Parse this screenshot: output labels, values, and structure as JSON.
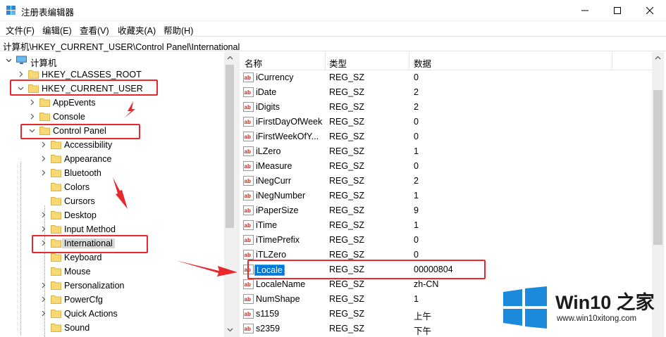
{
  "window": {
    "title": "注册表编辑器"
  },
  "menu": [
    {
      "label": "文件(F)"
    },
    {
      "label": "编辑(E)"
    },
    {
      "label": "查看(V)"
    },
    {
      "label": "收藏夹(A)"
    },
    {
      "label": "帮助(H)"
    }
  ],
  "address": {
    "path": "计算机\\HKEY_CURRENT_USER\\Control Panel\\International"
  },
  "tree": {
    "root": "计算机",
    "items": [
      {
        "label": "HKEY_CLASSES_ROOT",
        "expander": "collapsed"
      },
      {
        "label": "HKEY_CURRENT_USER",
        "expander": "expanded"
      },
      {
        "label": "AppEvents",
        "expander": "collapsed"
      },
      {
        "label": "Console",
        "expander": "collapsed"
      },
      {
        "label": "Control Panel",
        "expander": "expanded"
      },
      {
        "label": "Accessibility",
        "expander": "collapsed"
      },
      {
        "label": "Appearance",
        "expander": "collapsed"
      },
      {
        "label": "Bluetooth",
        "expander": "collapsed"
      },
      {
        "label": "Colors",
        "expander": "none"
      },
      {
        "label": "Cursors",
        "expander": "none"
      },
      {
        "label": "Desktop",
        "expander": "collapsed"
      },
      {
        "label": "Input Method",
        "expander": "collapsed"
      },
      {
        "label": "International",
        "expander": "collapsed",
        "selected": true
      },
      {
        "label": "Keyboard",
        "expander": "none"
      },
      {
        "label": "Mouse",
        "expander": "none"
      },
      {
        "label": "Personalization",
        "expander": "collapsed"
      },
      {
        "label": "PowerCfg",
        "expander": "collapsed"
      },
      {
        "label": "Quick Actions",
        "expander": "collapsed"
      },
      {
        "label": "Sound",
        "expander": "none"
      }
    ]
  },
  "list": {
    "columns": {
      "name": "名称",
      "type": "类型",
      "data": "数据"
    },
    "rows": [
      {
        "name": "iCurrency",
        "type": "REG_SZ",
        "data": "0"
      },
      {
        "name": "iDate",
        "type": "REG_SZ",
        "data": "2"
      },
      {
        "name": "iDigits",
        "type": "REG_SZ",
        "data": "2"
      },
      {
        "name": "iFirstDayOfWeek",
        "type": "REG_SZ",
        "data": "0"
      },
      {
        "name": "iFirstWeekOfY...",
        "type": "REG_SZ",
        "data": "0"
      },
      {
        "name": "iLZero",
        "type": "REG_SZ",
        "data": "1"
      },
      {
        "name": "iMeasure",
        "type": "REG_SZ",
        "data": "0"
      },
      {
        "name": "iNegCurr",
        "type": "REG_SZ",
        "data": "2"
      },
      {
        "name": "iNegNumber",
        "type": "REG_SZ",
        "data": "1"
      },
      {
        "name": "iPaperSize",
        "type": "REG_SZ",
        "data": "9"
      },
      {
        "name": "iTime",
        "type": "REG_SZ",
        "data": "1"
      },
      {
        "name": "iTimePrefix",
        "type": "REG_SZ",
        "data": "0"
      },
      {
        "name": "iTLZero",
        "type": "REG_SZ",
        "data": "0"
      },
      {
        "name": "Locale",
        "type": "REG_SZ",
        "data": "00000804",
        "selected": true
      },
      {
        "name": "LocaleName",
        "type": "REG_SZ",
        "data": "zh-CN"
      },
      {
        "name": "NumShape",
        "type": "REG_SZ",
        "data": "1"
      },
      {
        "name": "s1159",
        "type": "REG_SZ",
        "data": "上午"
      },
      {
        "name": "s2359",
        "type": "REG_SZ",
        "data": "下午"
      }
    ]
  },
  "watermark": {
    "brand": "Win10 之家",
    "url": "www.win10xitong.com"
  },
  "colors": {
    "annotation_red": "#e8282d",
    "selection_blue": "#0078d7",
    "folder_yellow": "#f8d775",
    "logo_blue": "#1c8adb"
  }
}
